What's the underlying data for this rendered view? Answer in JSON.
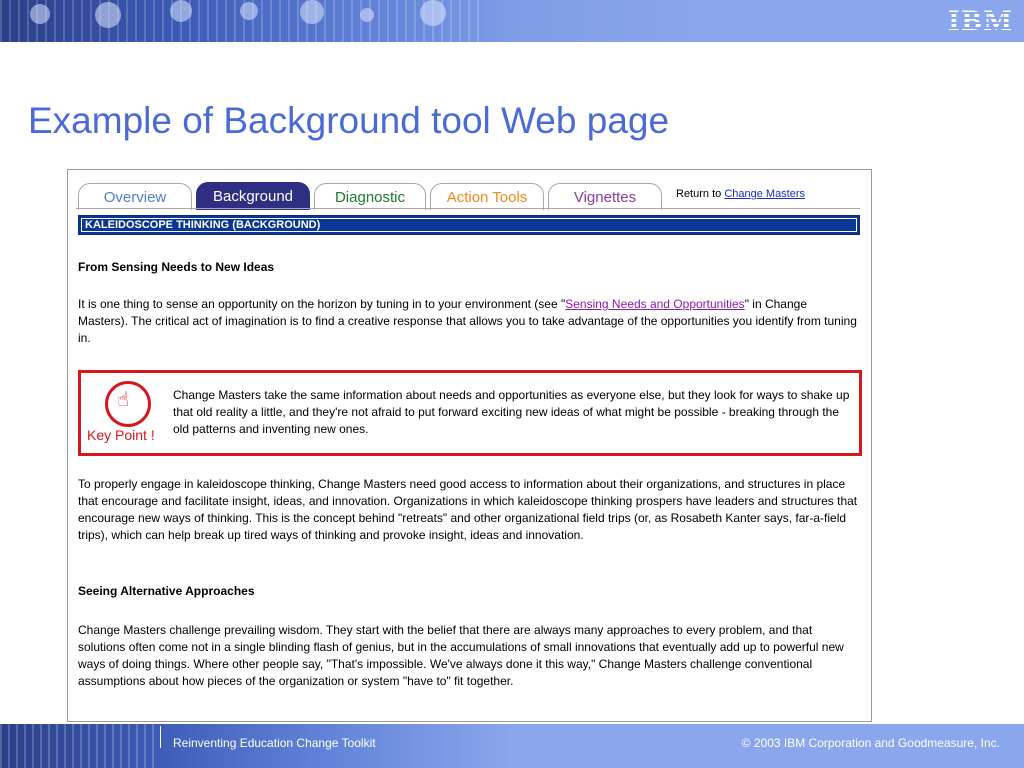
{
  "slide": {
    "title": "Example of Background tool Web page",
    "logo": "IBM",
    "footer_left": "Reinventing Education Change Toolkit",
    "footer_right": "© 2003 IBM Corporation and Goodmeasure, Inc."
  },
  "webpage": {
    "tabs": [
      {
        "label": "Overview"
      },
      {
        "label": "Background",
        "active": true
      },
      {
        "label": "Diagnostic"
      },
      {
        "label": "Action Tools"
      },
      {
        "label": "Vignettes"
      }
    ],
    "return_to_prefix": "Return to",
    "return_to_link": "Change Masters",
    "header": "KALEIDOSCOPE THINKING (BACKGROUND)",
    "section1_heading": "From Sensing Needs to New Ideas",
    "para1_before": "It is one thing to sense an opportunity on the horizon by tuning in to your environment (see \"",
    "para1_link": "Sensing Needs and Opportunities",
    "para1_after": "\" in Change Masters). The critical act of imagination is to find a creative response that allows you to take advantage of the opportunities you identify from tuning in.",
    "keypoint_label": "Key Point !",
    "keypoint_text": "Change Masters take the same information about needs and opportunities as everyone else, but they look for ways to shake up that old reality a little, and they're not afraid to put forward exciting new ideas of what might be possible - breaking through the old patterns and inventing new ones.",
    "para2": "To properly engage in kaleidoscope thinking, Change Masters need good access to information about their organizations, and structures in place that encourage and facilitate insight, ideas, and innovation. Organizations in which kaleidoscope thinking prospers have leaders and structures that encourage new ways of thinking. This is the concept behind \"retreats\" and other organizational field trips (or, as Rosabeth Kanter says, far-a-field trips), which can help break up tired ways of thinking and provoke insight, ideas and innovation.",
    "section2_heading": "Seeing Alternative Approaches",
    "para3": "Change Masters challenge prevailing wisdom. They start with the belief that there are always many approaches to every problem, and that solutions often come not in a single blinding flash of genius, but in the accumulations of small innovations that eventually add up to powerful new ways of doing things. Where other people say, \"That's impossible. We've always done it this way,\" Change Masters challenge conventional assumptions about how pieces of the organization or system \"have to\" fit together."
  },
  "colors": {
    "title": "#4a6bd6",
    "header_bar": "#0a3696",
    "keypoint_border": "#d8161c",
    "active_tab": "#2e2e82"
  }
}
